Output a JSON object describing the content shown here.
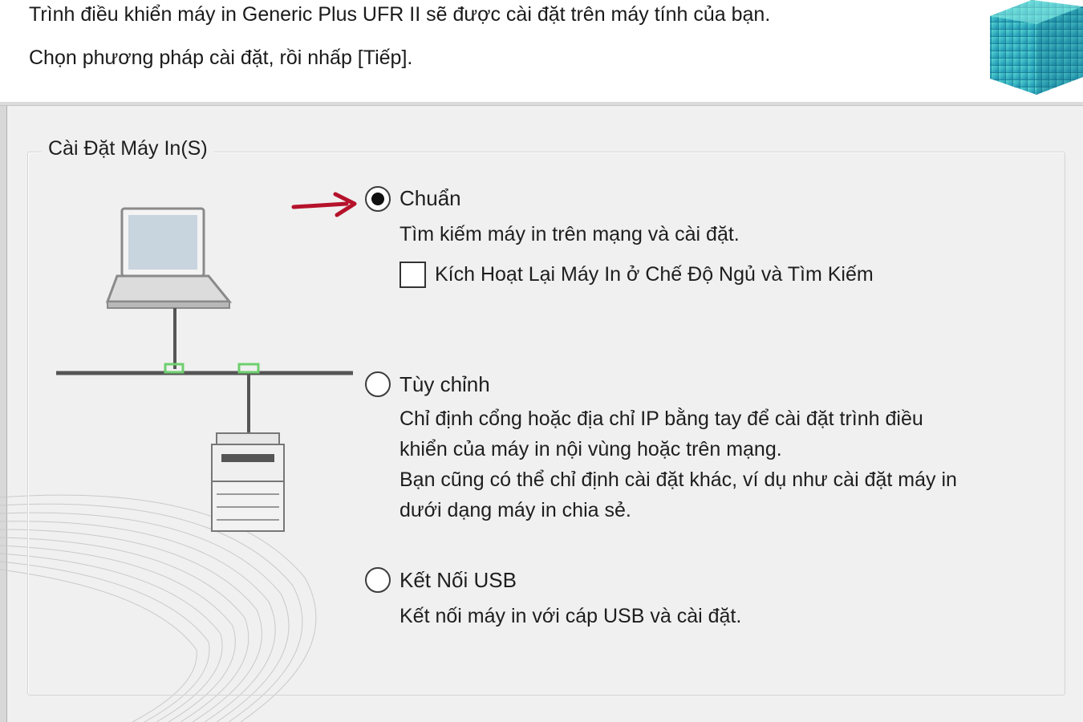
{
  "header": {
    "line1": "Trình điều khiển máy in Generic Plus UFR II sẽ được cài đặt trên máy tính của bạn.",
    "line2": "Chọn phương pháp cài đặt, rồi nhấp [Tiếp]."
  },
  "group": {
    "title": "Cài Đặt Máy In(S)"
  },
  "options": {
    "standard": {
      "label": "Chuẩn",
      "selected": true,
      "description": "Tìm kiếm máy in trên mạng và cài đặt.",
      "checkbox_label": "Kích Hoạt Lại Máy In ở Chế Độ Ngủ và Tìm Kiếm",
      "checkbox_checked": false
    },
    "custom": {
      "label": "Tùy chỉnh",
      "selected": false,
      "description_lines": [
        "Chỉ định cổng hoặc địa chỉ IP bằng tay để cài đặt trình điều",
        "khiển của máy in nội vùng hoặc trên mạng.",
        "Bạn cũng có thể chỉ định cài đặt khác, ví dụ như cài đặt máy in",
        "dưới dạng máy in chia sẻ."
      ]
    },
    "usb": {
      "label": "Kết Nối USB",
      "selected": false,
      "description": "Kết nối máy in với cáp USB và cài đặt."
    }
  },
  "colors": {
    "arrow": "#b5122b",
    "logo": "#1fa5b8",
    "network_port": "#6ecf6e"
  },
  "icons": {
    "logo": "cube-logo-icon",
    "illustration": "laptop-network-printer-icon",
    "pointer": "red-arrow-icon"
  }
}
